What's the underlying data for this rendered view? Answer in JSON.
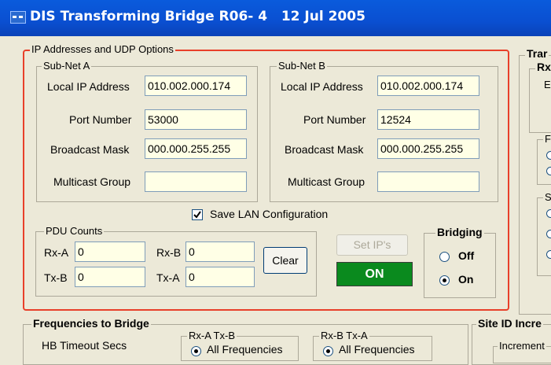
{
  "window": {
    "title": "DIS Transforming Bridge R06- 4   12 Jul 2005"
  },
  "ip_group": {
    "title": "IP Addresses and UDP Options",
    "subnet_a": {
      "title": "Sub-Net A",
      "local_ip_label": "Local IP Address",
      "local_ip": "010.002.000.174",
      "port_label": "Port Number",
      "port": "53000",
      "broadcast_label": "Broadcast Mask",
      "broadcast": "000.000.255.255",
      "multicast_label": "Multicast Group",
      "multicast": ""
    },
    "subnet_b": {
      "title": "Sub-Net B",
      "local_ip_label": "Local IP Address",
      "local_ip": "010.002.000.174",
      "port_label": "Port Number",
      "port": "12524",
      "broadcast_label": "Broadcast Mask",
      "broadcast": "000.000.255.255",
      "multicast_label": "Multicast Group",
      "multicast": ""
    },
    "save_lan": {
      "label": "Save LAN Configuration",
      "checked": true
    },
    "pdu_counts": {
      "title": "PDU Counts",
      "rxa_label": "Rx-A",
      "rxa": "0",
      "txb_label": "Tx-B",
      "txb": "0",
      "rxb_label": "Rx-B",
      "rxb": "0",
      "txa_label": "Tx-A",
      "txa": "0",
      "clear_label": "Clear"
    },
    "set_ips_label": "Set IP's",
    "status_label": "ON",
    "status_color": "#0a8a1e",
    "bridging": {
      "title": "Bridging",
      "off_label": "Off",
      "on_label": "On",
      "selected": "On"
    }
  },
  "right_panel": {
    "title": "Trar",
    "sub_title": "Rx",
    "frag_e": "E",
    "frag_f": "F",
    "frag_s": "S"
  },
  "frequencies": {
    "title": "Frequencies to Bridge",
    "hb_label": "HB Timeout Secs",
    "rxa_txb": {
      "title": "Rx-A  Tx-B",
      "option": "All Frequencies"
    },
    "rxb_txa": {
      "title": "Rx-B  Tx-A",
      "option": "All Frequencies"
    }
  },
  "site_id": {
    "title": "Site ID Incre",
    "sub": "Increment"
  },
  "colors": {
    "titlebar": "#0a4fd1",
    "highlight_border": "#e8402a",
    "field_bg": "#ffffe6"
  }
}
